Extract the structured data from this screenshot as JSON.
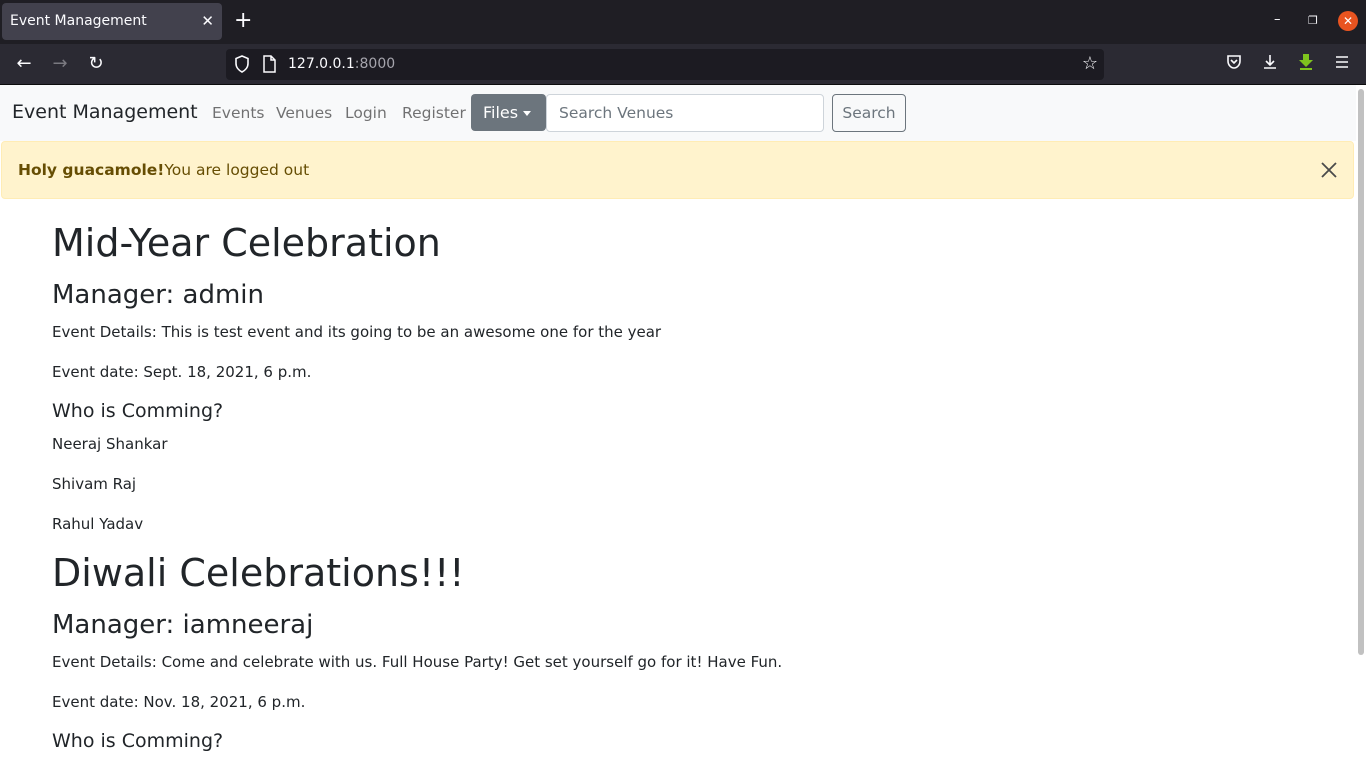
{
  "browser": {
    "tab_title": "Event Management",
    "tab_close": "✕",
    "new_tab": "+",
    "url_host": "127.0.0.1",
    "url_port": ":8000",
    "win_minimize": "–",
    "win_restore": "❐",
    "win_close": "✕"
  },
  "site": {
    "brand": "Event Management",
    "nav": [
      "Events",
      "Venues",
      "Login",
      "Register"
    ],
    "files_label": "Files",
    "search_placeholder": "Search Venues",
    "search_button": "Search"
  },
  "alert": {
    "strong": "Holy guacamole!",
    "message": "You are logged out"
  },
  "events": [
    {
      "title": "Mid-Year Celebration",
      "manager": "Manager: admin",
      "details": "Event Details: This is test event and its going to be an awesome one for the year",
      "date": "Event date: Sept. 18, 2021, 6 p.m.",
      "who_heading": "Who is Comming?",
      "attendees": [
        "Neeraj Shankar",
        "Shivam Raj",
        "Rahul Yadav"
      ]
    },
    {
      "title": "Diwali Celebrations!!!",
      "manager": "Manager: iamneeraj",
      "details": "Event Details: Come and celebrate with us. Full House Party! Get set yourself go for it! Have Fun.",
      "date": "Event date: Nov. 18, 2021, 6 p.m.",
      "who_heading": "Who is Comming?",
      "attendees": []
    }
  ],
  "colors": {
    "alert_bg": "#fff3cd",
    "alert_text": "#664d03",
    "files_button": "#6c757d",
    "win_close": "#e95420"
  }
}
